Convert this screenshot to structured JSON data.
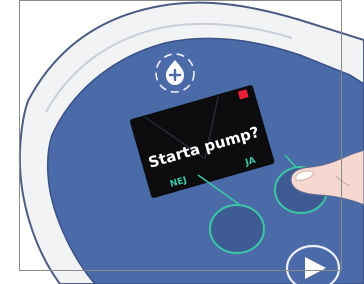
{
  "device": {
    "screen": {
      "prompt": "Starta pump?",
      "left_softkey_label": "NEJ",
      "right_softkey_label": "JA",
      "indicator_color": "#e8203a"
    },
    "top_icon": "infusion-drop-plus-icon",
    "bottom_icon": "play-triangle-icon"
  },
  "colors": {
    "casing": "#f2f3f5",
    "casing_outline": "#4b5d82",
    "panel": "#4a6aa8",
    "panel_dark": "#3e5b94",
    "screen": "#0c0c0e",
    "softkey_ring": "#3cc7a6",
    "screen_text": "#ffffff",
    "softkey_text": "#3cc7a6"
  }
}
